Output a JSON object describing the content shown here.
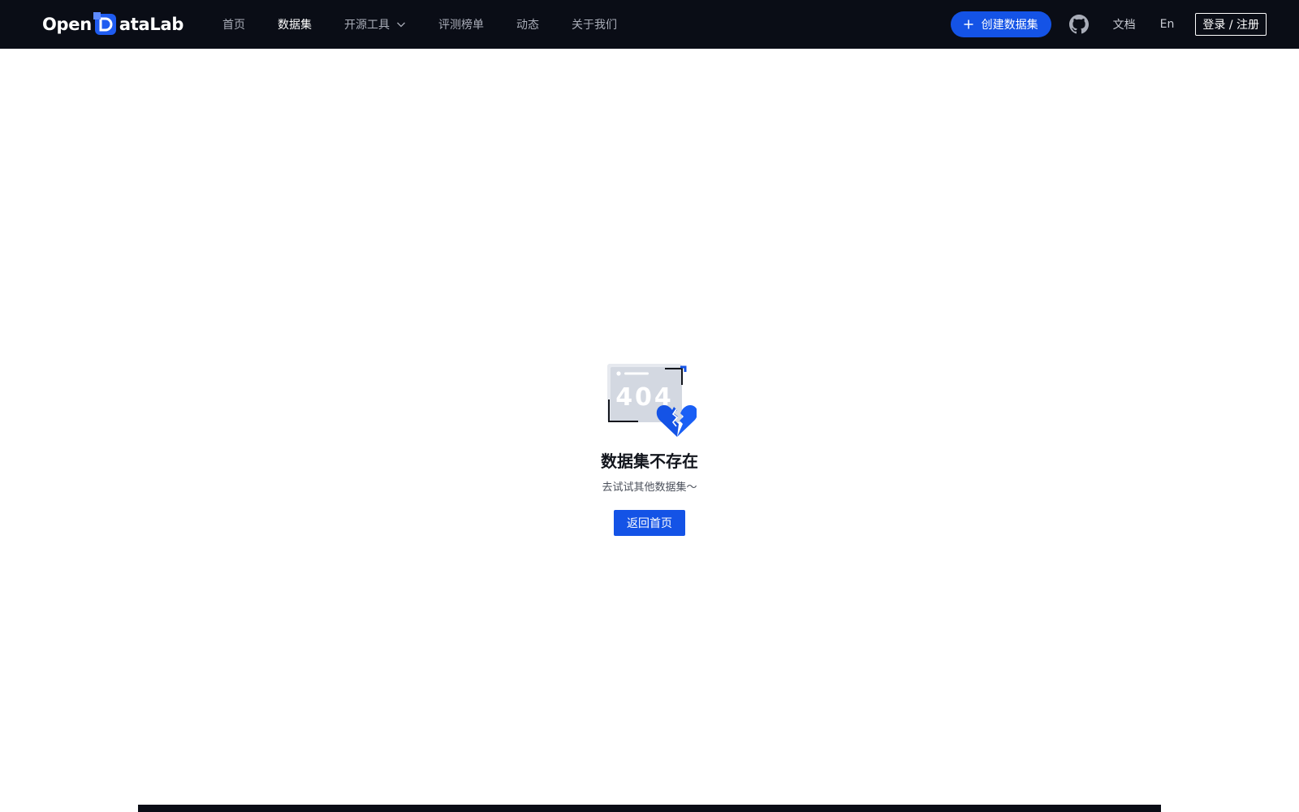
{
  "header": {
    "logo": {
      "part1": "Open",
      "part2": "ataLab"
    },
    "nav": [
      {
        "label": "首页"
      },
      {
        "label": "数据集"
      },
      {
        "label": "开源工具"
      },
      {
        "label": "评测榜单"
      },
      {
        "label": "动态"
      },
      {
        "label": "关于我们"
      }
    ],
    "active_nav": "数据集",
    "create_button": "创建数据集",
    "docs_link": "文档",
    "lang_link": "En",
    "login_button": "登录 / 注册"
  },
  "empty_state": {
    "illustration_text": "404",
    "title": "数据集不存在",
    "subtitle": "去试试其他数据集～",
    "home_button": "返回首页"
  },
  "colors": {
    "header_bg": "#0a0d16",
    "accent": "#1453e6",
    "text_dark": "#12151c"
  }
}
